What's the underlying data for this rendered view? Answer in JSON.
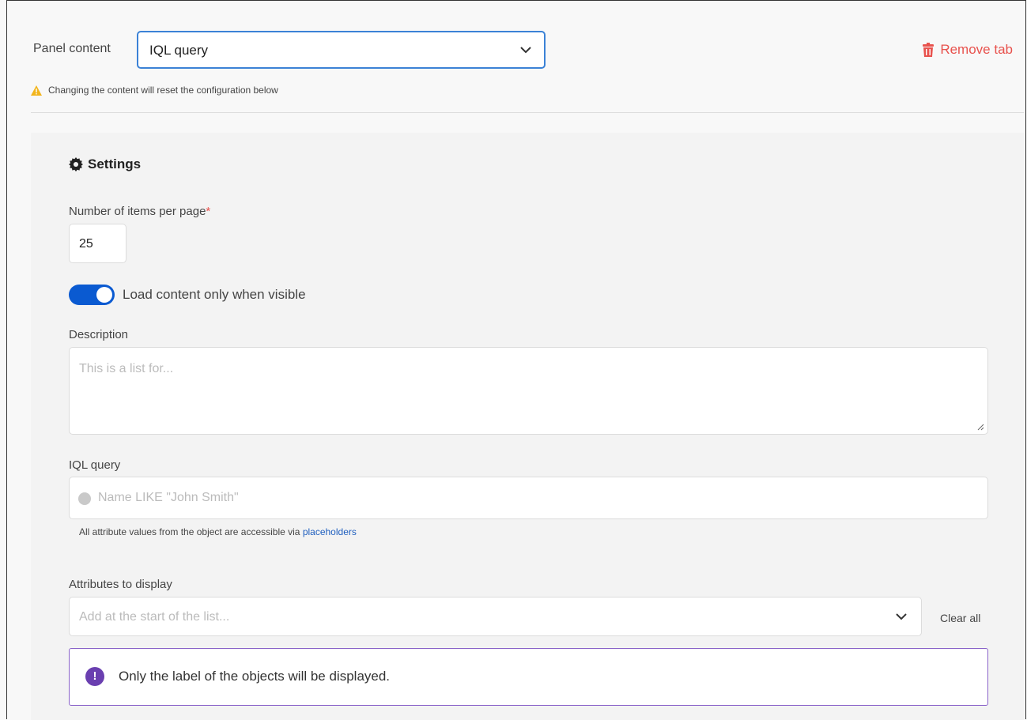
{
  "panel_content": {
    "label": "Panel content",
    "selected": "IQL query",
    "remove_tab": "Remove tab",
    "warning": "Changing the content will reset the configuration below"
  },
  "settings": {
    "title": "Settings",
    "items_per_page_label": "Number of items per page",
    "required_mark": "*",
    "items_per_page_value": "25",
    "toggle_label": "Load content only when visible",
    "toggle_on": true,
    "description_label": "Description",
    "description_placeholder": "This is a list for...",
    "iql_label": "IQL query",
    "iql_placeholder": "Name LIKE \"John Smith\"",
    "iql_hint": "All attribute values from the object are accessible via ",
    "iql_hint_link": "placeholders",
    "attributes_label": "Attributes to display",
    "attributes_placeholder": "Add at the start of the list...",
    "clear_all": "Clear all",
    "info_message": "Only the label of the objects will be displayed."
  },
  "colors": {
    "accent": "#3b82d6",
    "toggle": "#0a5ad1",
    "danger": "#e8524d",
    "info_purple": "#6a3fb0"
  }
}
